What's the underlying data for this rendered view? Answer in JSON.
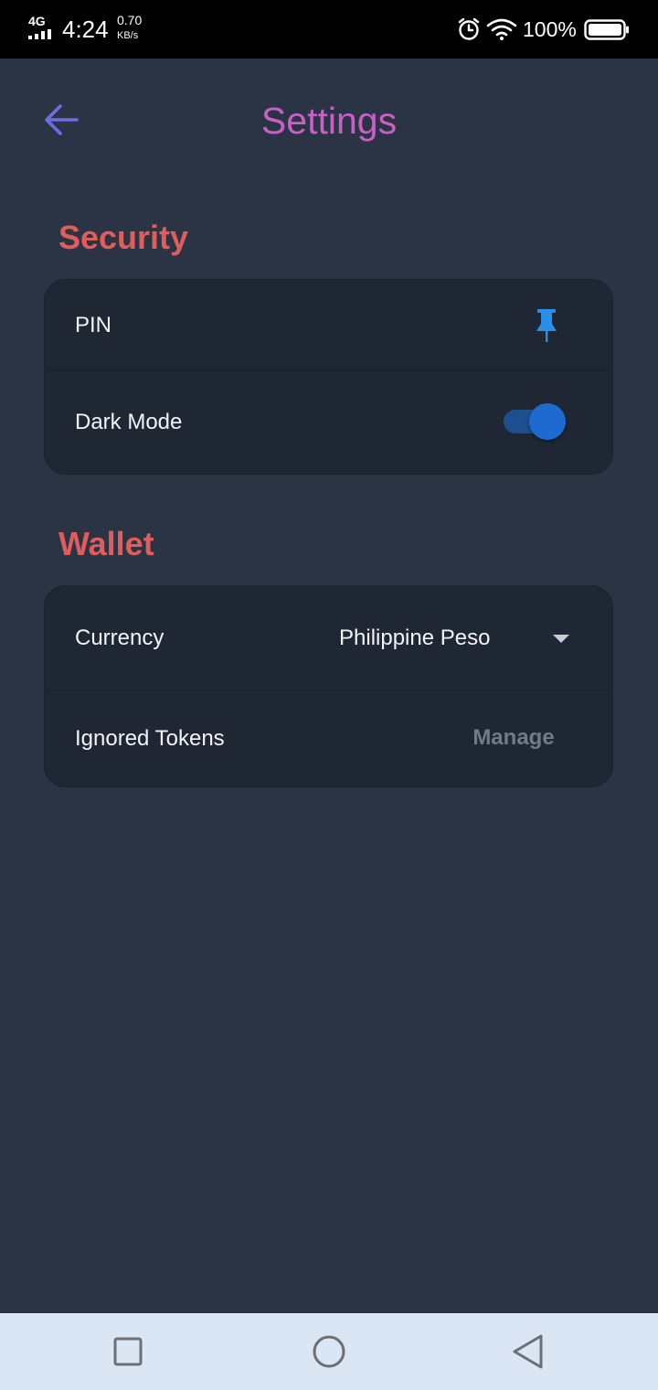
{
  "status_bar": {
    "network": "4G",
    "time": "4:24",
    "speed_value": "0.70",
    "speed_unit": "KB/s",
    "battery": "100%",
    "icons": [
      "signal-icon",
      "alarm-icon",
      "wifi-icon",
      "battery-icon"
    ]
  },
  "header": {
    "title": "Settings",
    "back_icon": "arrow-left-icon"
  },
  "sections": {
    "security": {
      "title": "Security",
      "pin_label": "PIN",
      "pin_icon": "pushpin-icon",
      "dark_mode_label": "Dark Mode",
      "dark_mode_enabled": true
    },
    "wallet": {
      "title": "Wallet",
      "currency_label": "Currency",
      "currency_value": "Philippine Peso",
      "ignored_tokens_label": "Ignored Tokens",
      "manage_label": "Manage"
    }
  },
  "nav_bar": {
    "buttons": [
      "recents-square-icon",
      "home-circle-icon",
      "back-triangle-icon"
    ]
  },
  "colors": {
    "background": "#2a3445",
    "card": "#1f2735",
    "title": "#cc5fc6",
    "section_title": "#e05d5c",
    "accent_blue": "#1e6ad0",
    "back_arrow": "#6c6fe0",
    "muted": "#727a85"
  }
}
